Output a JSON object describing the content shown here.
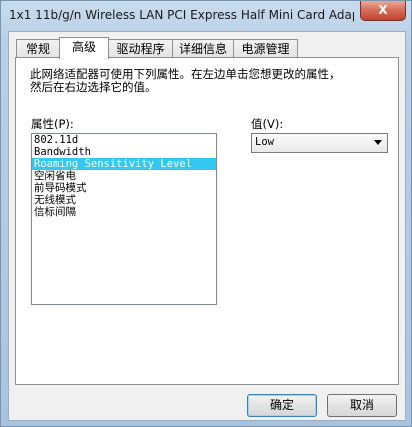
{
  "window": {
    "title": "1x1 11b/g/n Wireless LAN PCI Express Half Mini Card Adap...",
    "close_label": "X"
  },
  "tabs": [
    "常规",
    "高级",
    "驱动程序",
    "详细信息",
    "电源管理"
  ],
  "active_tab": "高级",
  "advanced": {
    "description_line1": "此网络适配器可使用下列属性。在左边单击您想更改的属性，",
    "description_line2": "然后在右边选择它的值。",
    "property_label": "属性(P):",
    "value_label": "值(V):",
    "properties": [
      "802.11d",
      "Bandwidth",
      "Roaming Sensitivity Level",
      "空闲省电",
      "前导码模式",
      "无线模式",
      "信标间隔"
    ],
    "selected_property": "Roaming Sensitivity Level",
    "value_selected": "Low"
  },
  "buttons": {
    "ok": "确定",
    "cancel": "取消"
  }
}
